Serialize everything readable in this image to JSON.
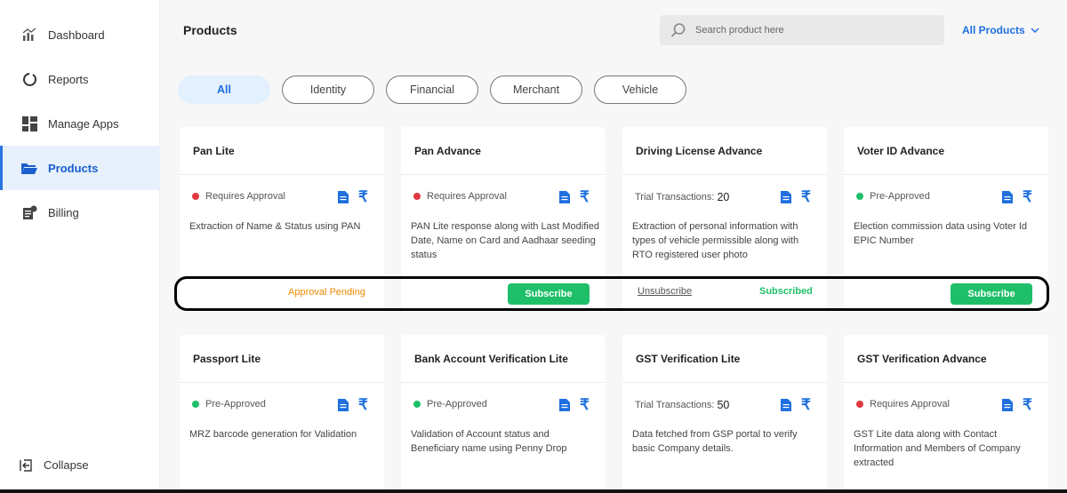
{
  "sidebar": {
    "items": [
      {
        "label": "Dashboard",
        "icon": "chart-icon"
      },
      {
        "label": "Reports",
        "icon": "reports-icon"
      },
      {
        "label": "Manage Apps",
        "icon": "apps-icon"
      },
      {
        "label": "Products",
        "icon": "folder-icon",
        "active": true
      },
      {
        "label": "Billing",
        "icon": "billing-icon"
      }
    ],
    "collapse_label": "Collapse"
  },
  "header": {
    "title": "Products",
    "search_placeholder": "Search product here",
    "dropdown_label": "All Products"
  },
  "filters": [
    {
      "label": "All",
      "active": true
    },
    {
      "label": "Identity"
    },
    {
      "label": "Financial"
    },
    {
      "label": "Merchant"
    },
    {
      "label": "Vehicle"
    }
  ],
  "cards_row1": [
    {
      "title": "Pan Lite",
      "status": "Requires Approval",
      "status_color": "#e0383e",
      "desc": "Extraction of Name & Status using PAN",
      "action": "Approval Pending"
    },
    {
      "title": "Pan Advance",
      "status": "Requires Approval",
      "status_color": "#e0383e",
      "desc": "PAN Lite response along with Last Modified Date, Name on Card and Aadhaar seeding status",
      "action": "Subscribe"
    },
    {
      "title": "Driving License Advance",
      "status": "Trial Transactions:",
      "trial_count": "20",
      "desc": "Extraction of personal information with types of vehicle permissible along with RTO registered user photo",
      "action_unsub": "Unsubscribe",
      "action_status": "Subscribed"
    },
    {
      "title": "Voter ID Advance",
      "status": "Pre-Approved",
      "status_color": "#1fbf6a",
      "desc": "Election commission data using Voter Id EPIC Number",
      "action": "Subscribe"
    }
  ],
  "cards_row2": [
    {
      "title": "Passport Lite",
      "status": "Pre-Approved",
      "status_color": "#1fbf6a",
      "desc": "MRZ barcode generation for Validation"
    },
    {
      "title": "Bank Account Verification Lite",
      "status": "Pre-Approved",
      "status_color": "#1fbf6a",
      "desc": "Validation of Account status and Beneficiary name using Penny Drop"
    },
    {
      "title": "GST Verification Lite",
      "status": "Trial Transactions:",
      "trial_count": "50",
      "desc": "Data fetched from GSP portal to verify basic Company details."
    },
    {
      "title": "GST Verification Advance",
      "status": "Requires Approval",
      "status_color": "#e0383e",
      "desc": "GST Lite data along with Contact Information and Members of Company extracted"
    }
  ],
  "rupee_symbol": "₹",
  "colors": {
    "accent": "#1f6fe0",
    "success": "#1fbf6a",
    "warning": "#f08a00",
    "danger": "#e0383e"
  }
}
